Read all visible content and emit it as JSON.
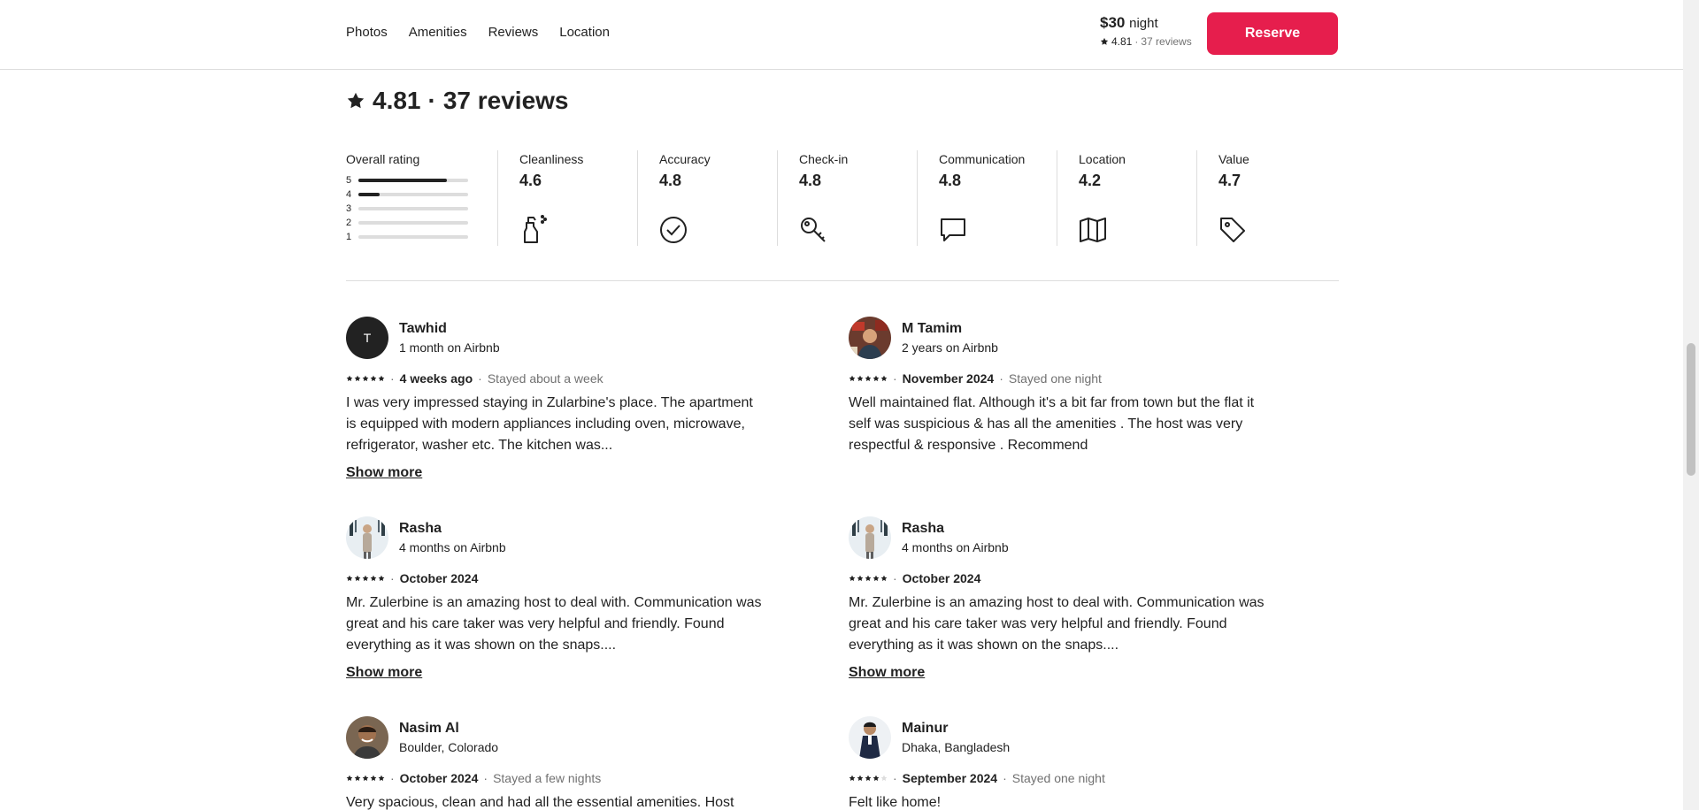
{
  "topbar": {
    "nav": [
      "Photos",
      "Amenities",
      "Reviews",
      "Location"
    ],
    "price": "$30",
    "price_unit": "night",
    "rating": "4.81",
    "reviews_count": "37 reviews",
    "reserve_label": "Reserve",
    "reserve_color": "#e61e4d"
  },
  "summary": {
    "rating": "4.81",
    "separator": "·",
    "reviews_count": "37 reviews"
  },
  "overall": {
    "title": "Overall rating",
    "distribution": [
      {
        "star": "5",
        "fraction": 0.81
      },
      {
        "star": "4",
        "fraction": 0.19
      },
      {
        "star": "3",
        "fraction": 0
      },
      {
        "star": "2",
        "fraction": 0
      },
      {
        "star": "1",
        "fraction": 0
      }
    ]
  },
  "categories": [
    {
      "title": "Cleanliness",
      "value": "4.6",
      "icon": "spray-bottle-icon"
    },
    {
      "title": "Accuracy",
      "value": "4.8",
      "icon": "check-circle-icon"
    },
    {
      "title": "Check-in",
      "value": "4.8",
      "icon": "key-icon"
    },
    {
      "title": "Communication",
      "value": "4.8",
      "icon": "chat-bubble-icon"
    },
    {
      "title": "Location",
      "value": "4.2",
      "icon": "map-icon"
    },
    {
      "title": "Value",
      "value": "4.7",
      "icon": "tag-icon"
    }
  ],
  "reviews": [
    {
      "name": "Tawhid",
      "initial": "T",
      "sub": "1 month on Airbnb",
      "stars": 5,
      "when": "4 weeks ago",
      "stay": "Stayed about a week",
      "text": "I was very impressed staying in Zularbine's place. The apartment is equipped with modern appliances including oven, microwave, refrigerator, washer etc. The kitchen was...",
      "show_more": "Show more"
    },
    {
      "name": "M Tamim",
      "sub": "2 years on Airbnb",
      "stars": 5,
      "when": "November 2024",
      "stay": "Stayed one night",
      "text": "Well maintained flat. Although it's a bit far from town but the flat it self was suspicious & has all the amenities . The host was very respectful & responsive . Recommend",
      "show_more": ""
    },
    {
      "name": "Rasha",
      "sub": "4 months on Airbnb",
      "stars": 5,
      "when": "October 2024",
      "stay": "",
      "text": "Mr. Zulerbine is an amazing host to deal with. Communication was great and his care taker was very helpful and friendly. Found everything as it was shown on the snaps....",
      "show_more": "Show more"
    },
    {
      "name": "Rasha",
      "sub": "4 months on Airbnb",
      "stars": 5,
      "when": "October 2024",
      "stay": "",
      "text": "Mr. Zulerbine is an amazing host to deal with. Communication was great and his care taker was very helpful and friendly. Found everything as it was shown on the snaps....",
      "show_more": "Show more"
    },
    {
      "name": "Nasim Al",
      "sub": "Boulder, Colorado",
      "stars": 5,
      "when": "October 2024",
      "stay": "Stayed a few nights",
      "text": "Very spacious, clean and had all the essential amenities. Host",
      "show_more": ""
    },
    {
      "name": "Mainur",
      "sub": "Dhaka, Bangladesh",
      "stars": 4,
      "when": "September 2024",
      "stay": "Stayed one night",
      "text": "Felt like home!",
      "show_more": ""
    }
  ]
}
